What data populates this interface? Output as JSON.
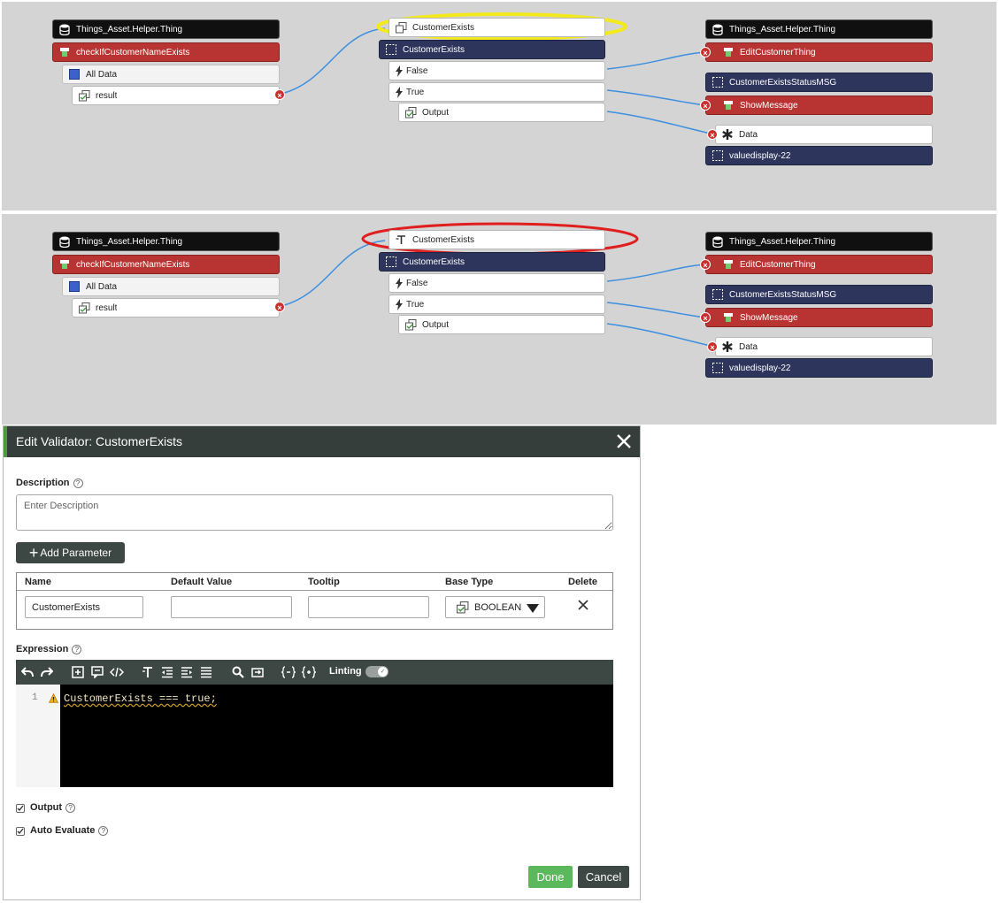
{
  "top_panel": {
    "left": {
      "thing": "Things_Asset.Helper.Thing",
      "service": "checkIfCustomerNameExists",
      "all_data": "All Data",
      "result": "result"
    },
    "middle": {
      "param": "CustomerExists",
      "validator": "CustomerExists",
      "false_event": "False",
      "true_event": "True",
      "output": "Output",
      "highlight_color": "#f2ea1c"
    },
    "right": {
      "thing": "Things_Asset.Helper.Thing",
      "edit_service": "EditCustomerThing",
      "status_msg": "CustomerExistsStatusMSG",
      "show_message": "ShowMessage",
      "data": "Data",
      "valuedisplay": "valuedisplay-22"
    }
  },
  "bottom_panel": {
    "left": {
      "thing": "Things_Asset.Helper.Thing",
      "service": "checkIfCustomerNameExists",
      "all_data": "All Data",
      "result": "result"
    },
    "middle": {
      "param": "CustomerExists",
      "validator": "CustomerExists",
      "false_event": "False",
      "true_event": "True",
      "output": "Output",
      "highlight_color": "#e01e1e"
    },
    "right": {
      "thing": "Things_Asset.Helper.Thing",
      "edit_service": "EditCustomerThing",
      "status_msg": "CustomerExistsStatusMSG",
      "show_message": "ShowMessage",
      "data": "Data",
      "valuedisplay": "valuedisplay-22"
    }
  },
  "dialog": {
    "title": "Edit Validator: CustomerExists",
    "description_label": "Description",
    "description_placeholder": "Enter Description",
    "add_parameter": "Add Parameter",
    "table_headers": {
      "name": "Name",
      "default_value": "Default Value",
      "tooltip": "Tooltip",
      "base_type": "Base Type",
      "delete": "Delete"
    },
    "param_row": {
      "name": "CustomerExists",
      "default_value": "",
      "tooltip": "",
      "base_type": "BOOLEAN"
    },
    "expression_label": "Expression",
    "linting_label": "Linting",
    "code_line_number": "1",
    "code": "CustomerExists === true;",
    "output_label": "Output",
    "auto_evaluate_label": "Auto Evaluate",
    "done": "Done",
    "cancel": "Cancel"
  },
  "colors": {
    "accent_green": "#5cb85c",
    "header_dark": "#353e3a",
    "service_red": "#b83432",
    "widget_navy": "#2e355d",
    "wire_blue": "#3d8fe0"
  },
  "icons": [
    "database-icon",
    "service-icon",
    "grid-icon",
    "boolean-icon",
    "widget-icon",
    "event-icon",
    "asterisk-icon",
    "text-icon",
    "remove-icon",
    "close-icon"
  ]
}
